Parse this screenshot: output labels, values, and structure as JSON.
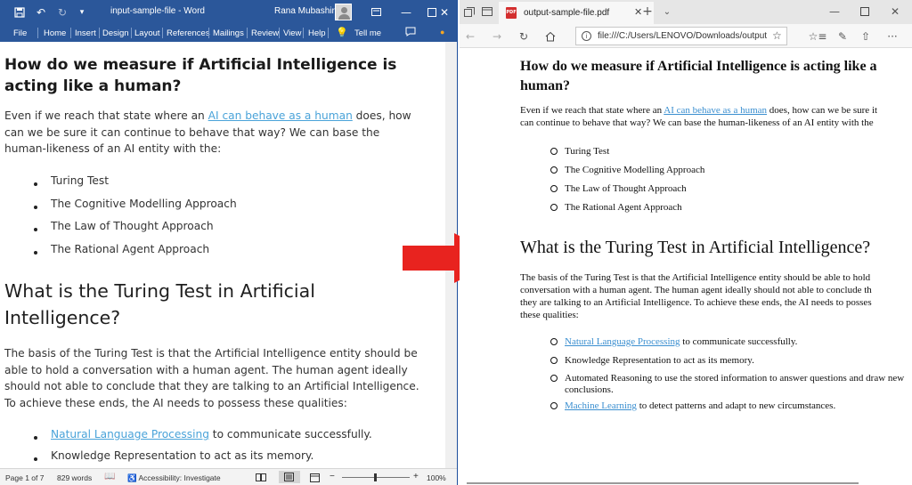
{
  "word": {
    "title": "input-sample-file  -  Word",
    "user": "Rana Mubashir",
    "ribbon_tabs": [
      "File",
      "Home",
      "Insert",
      "Design",
      "Layout",
      "References",
      "Mailings",
      "Review",
      "View",
      "Help",
      "Tell me"
    ],
    "heading": "How do we measure if Artificial Intelligence is acting like a human?",
    "para1": {
      "before": "Even if we reach that state where an ",
      "link": "AI can behave as a human",
      "after": " does, how can we be sure it can continue to behave that way? We can base the human-likeness of an AI entity with the:"
    },
    "list1": [
      "Turing Test",
      "The Cognitive Modelling Approach",
      "The Law of Thought Approach",
      "The Rational Agent Approach"
    ],
    "heading2": "What is the Turing Test in Artificial Intelligence?",
    "para2": "The basis of the Turing Test is that the Artificial Intelligence entity should be able to hold a conversation with a human agent. The human agent ideally should not able to conclude that they are talking to an Artificial Intelligence. To achieve these ends, the AI needs to possess these qualities:",
    "list2": [
      {
        "link": "Natural Language Processing",
        "text": " to communicate successfully."
      },
      {
        "link": "",
        "text": "Knowledge Representation to act as its memory."
      }
    ],
    "status": {
      "page": "Page 1 of 7",
      "words": "829 words",
      "accessibility": "Accessibility: Investigate",
      "zoom": "100%"
    }
  },
  "edge": {
    "tab_title": "output-sample-file.pdf",
    "url": "file:///C:/Users/LENOVO/Downloads/output",
    "pdf_badge": "PDF",
    "heading": "How do we measure if Artificial Intelligence is acting like a human?",
    "para1": {
      "line1_before": "Even if we reach that state where an ",
      "link": "AI can behave as a human",
      "line1_after": " does, how can we be sure it",
      "line2": "can continue to behave that way? We can base the human-likeness of an AI entity with the"
    },
    "list1": [
      "Turing Test",
      "The Cognitive Modelling Approach",
      "The Law of Thought Approach",
      "The Rational Agent Approach"
    ],
    "heading2": "What is the Turing Test in Artificial Intelligence?",
    "para2_lines": [
      "The basis of the Turing Test is that the Artificial Intelligence entity should be able to hold",
      "conversation with a human agent. The human agent ideally should not able to conclude th",
      "they are talking to an Artificial Intelligence. To achieve these ends, the AI needs to posses",
      "these qualities:"
    ],
    "list2": [
      {
        "link": "Natural Language Processing",
        "text": " to communicate successfully."
      },
      {
        "link": "",
        "text": "Knowledge Representation to act as its memory."
      },
      {
        "link": "",
        "text": "Automated Reasoning to use the stored information to answer questions and draw new",
        "text2": "conclusions."
      },
      {
        "link": "Machine Learning",
        "text": " to detect patterns and adapt to new circumstances."
      }
    ]
  },
  "colors": {
    "word_blue": "#2b579a",
    "link_word": "#4aa3d9",
    "link_pdf": "#3b8fd0",
    "arrow_red": "#e8231f"
  }
}
